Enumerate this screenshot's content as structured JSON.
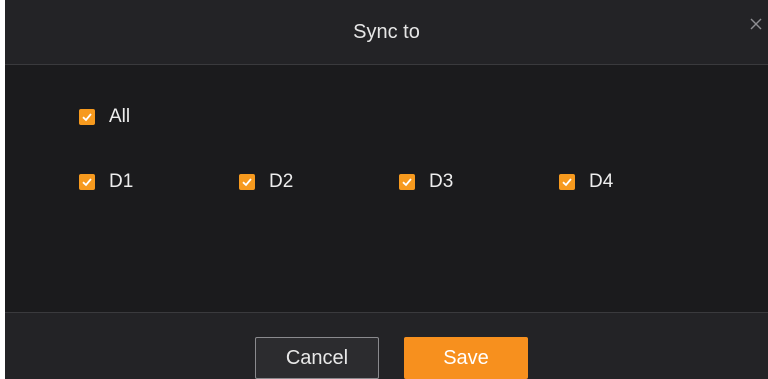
{
  "dialog": {
    "title": "Sync to",
    "close_icon": "close-icon"
  },
  "checkboxes": {
    "all": {
      "label": "All",
      "checked": true
    },
    "channels": [
      {
        "label": "D1",
        "checked": true
      },
      {
        "label": "D2",
        "checked": true
      },
      {
        "label": "D3",
        "checked": true
      },
      {
        "label": "D4",
        "checked": true
      }
    ]
  },
  "footer": {
    "cancel_label": "Cancel",
    "save_label": "Save"
  },
  "colors": {
    "accent": "#f7901e",
    "dialog_bg": "#1b1b1d",
    "header_bg": "#232326"
  }
}
